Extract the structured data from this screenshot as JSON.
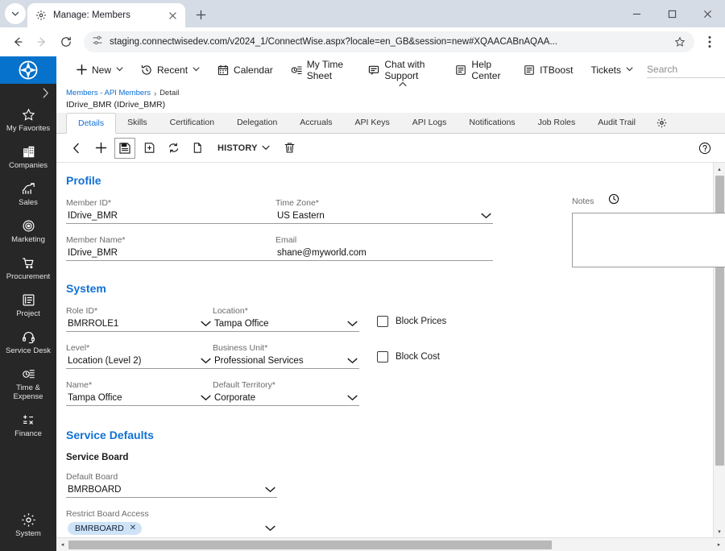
{
  "browser": {
    "tab": {
      "title": "Manage: Members",
      "favicon": "gear-favicon"
    },
    "tab_list_icon": "chevron-down-icon",
    "new_tab_icon": "plus-icon",
    "window": {
      "minimize": "–",
      "maximize": "▢",
      "close": "✕"
    },
    "nav": {
      "back": "←",
      "forward": "→",
      "reload": "⟳"
    },
    "url": "staging.connectwisedev.com/v2024_1/ConnectWise.aspx?locale=en_GB&session=new#XQAACABnAQAA...",
    "site_icon": "site-settings-icon",
    "bookmark_icon": "star-icon",
    "menu_icon": "kebab-menu-icon"
  },
  "sidebar": {
    "logo": "connectwise-compass-logo",
    "expand_icon": "chevron-right-icon",
    "items": [
      {
        "label": "My Favorites",
        "icon": "star-icon"
      },
      {
        "label": "Companies",
        "icon": "building-icon"
      },
      {
        "label": "Sales",
        "icon": "chart-growth-icon"
      },
      {
        "label": "Marketing",
        "icon": "target-icon"
      },
      {
        "label": "Procurement",
        "icon": "shopping-cart-icon"
      },
      {
        "label": "Project",
        "icon": "project-list-icon"
      },
      {
        "label": "Service Desk",
        "icon": "headset-icon"
      },
      {
        "label": "Time & Expense",
        "icon": "time-clock-icon"
      },
      {
        "label": "Finance",
        "icon": "calculator-icon"
      }
    ],
    "bottom_item": {
      "label": "System",
      "icon": "gear-icon"
    }
  },
  "topnav": {
    "items": [
      {
        "label": "New",
        "icon": "plus-icon",
        "caret": "⌄"
      },
      {
        "label": "Recent",
        "icon": "recent-clock-icon",
        "caret": "⌄"
      },
      {
        "label": "Calendar",
        "icon": "calendar-icon",
        "caret": ""
      },
      {
        "label": "My Time Sheet",
        "icon": "timesheet-icon",
        "caret": ""
      },
      {
        "label": "Chat with Support",
        "icon": "chat-bubble-icon",
        "caret": "",
        "subcaret": "⌃"
      },
      {
        "label": "Help Center",
        "icon": "book-icon",
        "caret": ""
      },
      {
        "label": "ITBoost",
        "icon": "itboost-icon",
        "caret": ""
      },
      {
        "label": "Tickets",
        "icon": "",
        "caret": "⌄"
      }
    ],
    "search_placeholder": "Search"
  },
  "breadcrumb": {
    "root": "Members - API Members",
    "separator": "›",
    "current": "Detail",
    "record_title": "IDrive_BMR (IDrive_BMR)"
  },
  "tabs": {
    "items": [
      "Details",
      "Skills",
      "Certification",
      "Delegation",
      "Accruals",
      "API Keys",
      "API Logs",
      "Notifications",
      "Job Roles",
      "Audit Trail"
    ],
    "active": "Details",
    "settings_icon": "gear-icon"
  },
  "actionbar": {
    "buttons": [
      {
        "name": "back-arrow",
        "icon": "chevron-left-icon"
      },
      {
        "name": "new-record",
        "icon": "plus-icon"
      },
      {
        "name": "save",
        "icon": "save-disk-icon",
        "selected": true
      },
      {
        "name": "save-and-new",
        "icon": "save-new-icon"
      },
      {
        "name": "refresh",
        "icon": "refresh-icon"
      },
      {
        "name": "copy",
        "icon": "copy-icon"
      }
    ],
    "history_label": "HISTORY",
    "history_caret": "⌄",
    "delete_icon": "trash-icon",
    "help_icon": "help-circle-icon"
  },
  "form": {
    "profile": {
      "heading": "Profile",
      "fields": [
        {
          "label": "Member ID*",
          "value": "IDrive_BMR",
          "type": "text"
        },
        {
          "label": "Member Name*",
          "value": "IDrive_BMR",
          "type": "text"
        },
        {
          "label": "Time Zone*",
          "value": "US Eastern",
          "type": "select"
        },
        {
          "label": "Email",
          "value": "shane@myworld.com",
          "type": "text"
        }
      ],
      "notes": {
        "label": "Notes",
        "icon": "clock-icon",
        "value": ""
      }
    },
    "system": {
      "heading": "System",
      "fields": [
        {
          "label": "Role ID*",
          "value": "BMRROLE1",
          "type": "select"
        },
        {
          "label": "Level*",
          "value": "Location (Level 2)",
          "type": "select"
        },
        {
          "label": "Name*",
          "value": "Tampa Office",
          "type": "select"
        },
        {
          "label": "Location*",
          "value": "Tampa Office",
          "type": "select"
        },
        {
          "label": "Business Unit*",
          "value": "Professional Services",
          "type": "select"
        },
        {
          "label": "Default Territory*",
          "value": "Corporate",
          "type": "select"
        }
      ],
      "checkboxes": [
        {
          "label": "Block Prices",
          "checked": false
        },
        {
          "label": "Block Cost",
          "checked": false
        }
      ]
    },
    "service_defaults": {
      "heading": "Service Defaults",
      "subheading": "Service Board",
      "default_board": {
        "label": "Default Board",
        "value": "BMRBOARD"
      },
      "restrict_board_access": {
        "label": "Restrict Board Access",
        "chip": "BMRBOARD",
        "chip_remove": "✕"
      }
    }
  },
  "scrollbars": {
    "vertical": {
      "up": "▴",
      "down": "▾"
    },
    "horizontal": {
      "left": "◂",
      "right": "▸"
    }
  },
  "colors": {
    "accent_blue": "#1271d4",
    "logo_blue": "#0672cb",
    "sidebar_bg": "#272727",
    "chip_bg": "#cfe3f7"
  }
}
